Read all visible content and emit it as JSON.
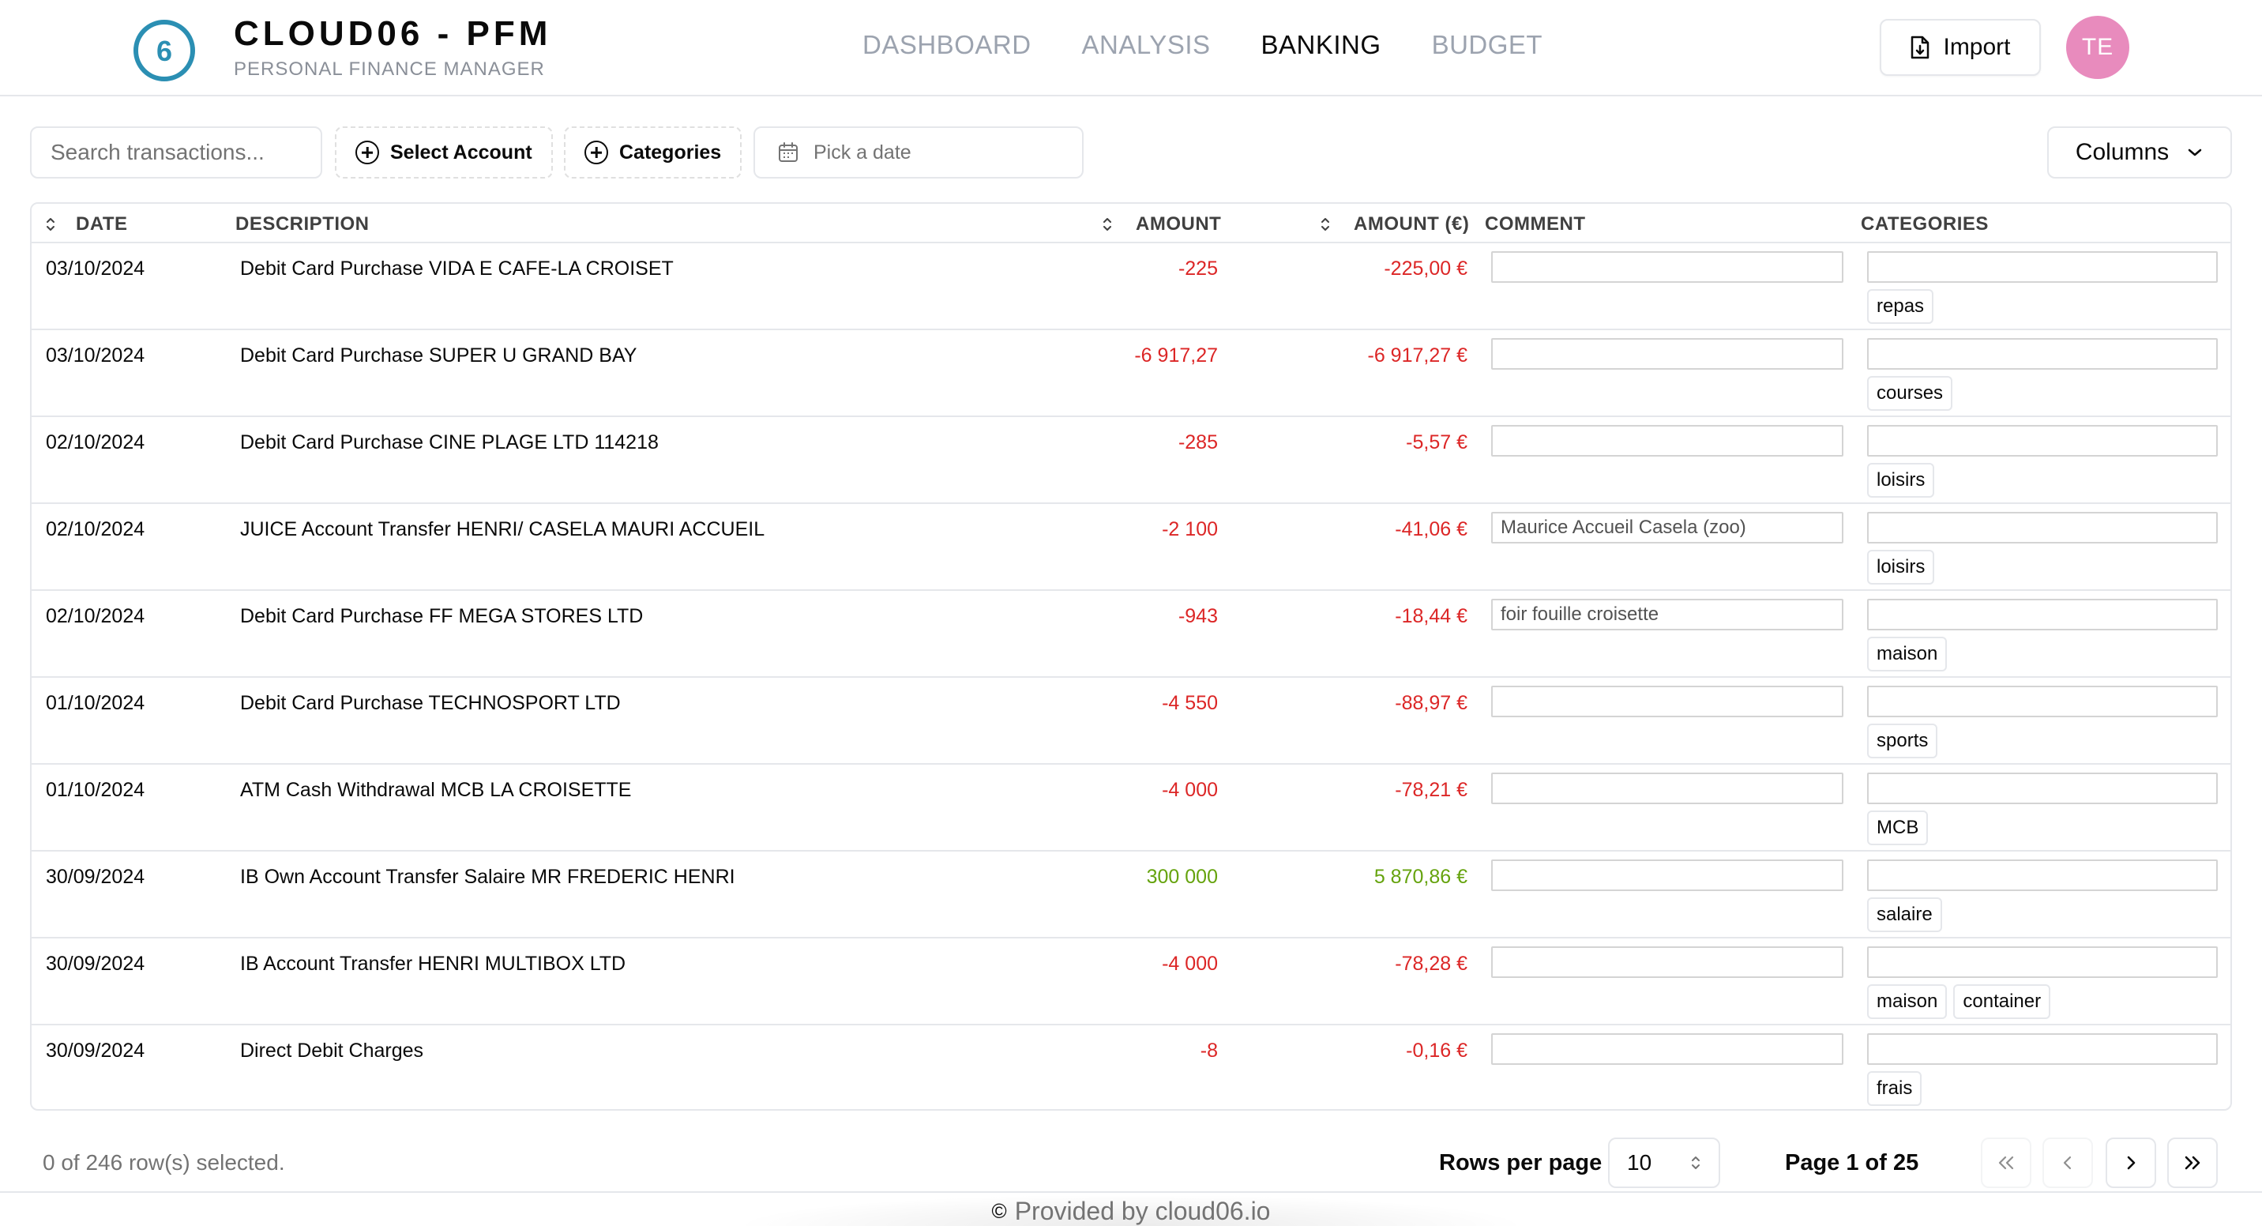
{
  "app": {
    "logo_glyph": "6",
    "title": "CLOUD06 - PFM",
    "subtitle": "PERSONAL FINANCE MANAGER"
  },
  "nav": [
    {
      "label": "DASHBOARD",
      "active": false
    },
    {
      "label": "ANALYSIS",
      "active": false
    },
    {
      "label": "BANKING",
      "active": true
    },
    {
      "label": "BUDGET",
      "active": false
    }
  ],
  "header": {
    "import_label": "Import",
    "import_icon": "file-import-icon",
    "avatar_initials": "TE"
  },
  "toolbar": {
    "search_placeholder": "Search transactions...",
    "select_account_label": "Select Account",
    "categories_label": "Categories",
    "date_placeholder": "Pick a date",
    "columns_label": "Columns"
  },
  "table": {
    "headers": {
      "date": "DATE",
      "description": "DESCRIPTION",
      "amount": "AMOUNT",
      "amount_eur": "AMOUNT (€)",
      "comment": "COMMENT",
      "categories": "CATEGORIES"
    },
    "rows": [
      {
        "date": "03/10/2024",
        "description": "Debit Card Purchase VIDA E CAFE-LA CROISET",
        "amount": "-225",
        "amount_eur": "-225,00 €",
        "sign": "neg",
        "comment": "",
        "categories": [
          "repas"
        ]
      },
      {
        "date": "03/10/2024",
        "description": "Debit Card Purchase SUPER U GRAND BAY",
        "amount": "-6 917,27",
        "amount_eur": "-6 917,27 €",
        "sign": "neg",
        "comment": "",
        "categories": [
          "courses"
        ]
      },
      {
        "date": "02/10/2024",
        "description": "Debit Card Purchase CINE PLAGE LTD 114218",
        "amount": "-285",
        "amount_eur": "-5,57 €",
        "sign": "neg",
        "comment": "",
        "categories": [
          "loisirs"
        ]
      },
      {
        "date": "02/10/2024",
        "description": "JUICE Account Transfer HENRI/ CASELA MAURI ACCUEIL",
        "amount": "-2 100",
        "amount_eur": "-41,06 €",
        "sign": "neg",
        "comment": "Maurice Accueil Casela (zoo)",
        "categories": [
          "loisirs"
        ]
      },
      {
        "date": "02/10/2024",
        "description": "Debit Card Purchase FF MEGA STORES LTD",
        "amount": "-943",
        "amount_eur": "-18,44 €",
        "sign": "neg",
        "comment": "foir fouille croisette",
        "categories": [
          "maison"
        ]
      },
      {
        "date": "01/10/2024",
        "description": "Debit Card Purchase TECHNOSPORT LTD",
        "amount": "-4 550",
        "amount_eur": "-88,97 €",
        "sign": "neg",
        "comment": "",
        "categories": [
          "sports"
        ]
      },
      {
        "date": "01/10/2024",
        "description": "ATM Cash Withdrawal MCB LA CROISETTE",
        "amount": "-4 000",
        "amount_eur": "-78,21 €",
        "sign": "neg",
        "comment": "",
        "categories": [
          "MCB"
        ]
      },
      {
        "date": "30/09/2024",
        "description": "IB Own Account Transfer Salaire MR FREDERIC HENRI",
        "amount": "300 000",
        "amount_eur": "5 870,86 €",
        "sign": "pos",
        "comment": "",
        "categories": [
          "salaire"
        ]
      },
      {
        "date": "30/09/2024",
        "description": "IB Account Transfer HENRI MULTIBOX LTD",
        "amount": "-4 000",
        "amount_eur": "-78,28 €",
        "sign": "neg",
        "comment": "",
        "categories": [
          "maison",
          "container"
        ]
      },
      {
        "date": "30/09/2024",
        "description": "Direct Debit Charges",
        "amount": "-8",
        "amount_eur": "-0,16 €",
        "sign": "neg",
        "comment": "",
        "categories": [
          "frais"
        ]
      }
    ]
  },
  "footer": {
    "selected_info": "0 of 246 row(s) selected.",
    "rows_per_page_label": "Rows per page",
    "rows_per_page_value": "10",
    "page_info": "Page 1 of 25",
    "provided_by": "Provided by cloud06.io",
    "copyright_symbol": "©"
  },
  "colors": {
    "accent": "#2b8fb3",
    "negative": "#dc2626",
    "positive": "#65a30d",
    "avatar": "#e88bbd"
  }
}
